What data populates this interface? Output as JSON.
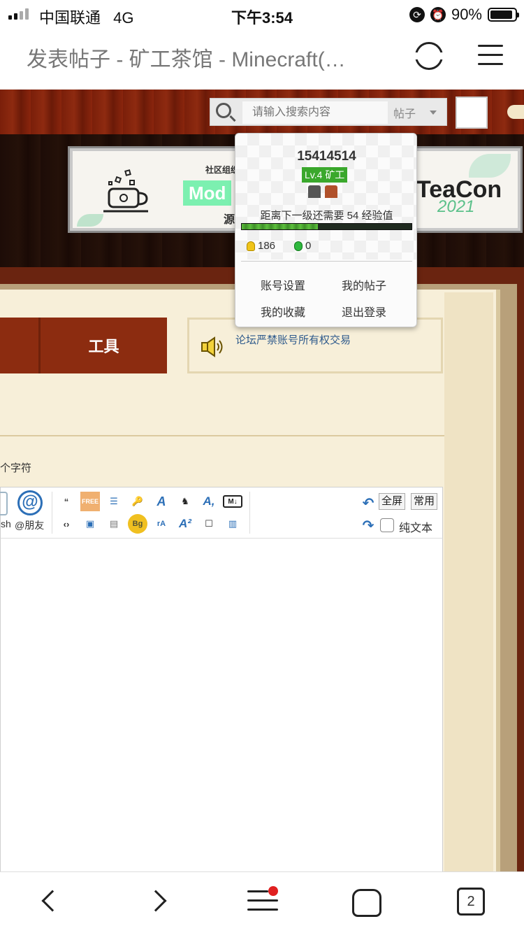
{
  "status_bar": {
    "carrier": "中国联通",
    "network": "4G",
    "time": "下午3:54",
    "battery_text": "90%",
    "battery_level": 0.9
  },
  "browser": {
    "page_title": "发表帖子 - 矿工茶馆 - Minecraft(…",
    "tab_count": "2"
  },
  "header": {
    "search_placeholder": "请输入搜索内容",
    "search_type": "帖子"
  },
  "banner": {
    "line1": "社区组织",
    "mod_label": "Mod",
    "line2": "源",
    "brand": "TeaCon",
    "year": "2021"
  },
  "nav": {
    "tools_label": "工具"
  },
  "notice": {
    "text": "论坛严禁账号所有权交易"
  },
  "form": {
    "char_hint": "个字符"
  },
  "toolbar": {
    "flash_label": "sh",
    "mention_label": "@朋友",
    "fullscreen_label": "全屏",
    "common_label": "常用",
    "plaintext_label": "纯文本"
  },
  "user_popup": {
    "username": "15414514",
    "level": "Lv.4 矿工",
    "exp_text": "距离下一级还需要 54 经验值",
    "exp_progress": 0.45,
    "gold": "186",
    "gems": "0",
    "links": {
      "account_settings": "账号设置",
      "my_posts": "我的帖子",
      "my_favorites": "我的收藏",
      "logout": "退出登录"
    }
  },
  "colors": {
    "forum_red": "#8c2c10",
    "parchment": "#f7efd9",
    "level_green": "#3aa82c",
    "notice_link": "#2e5a8c",
    "badge_dot": "#e02020"
  }
}
